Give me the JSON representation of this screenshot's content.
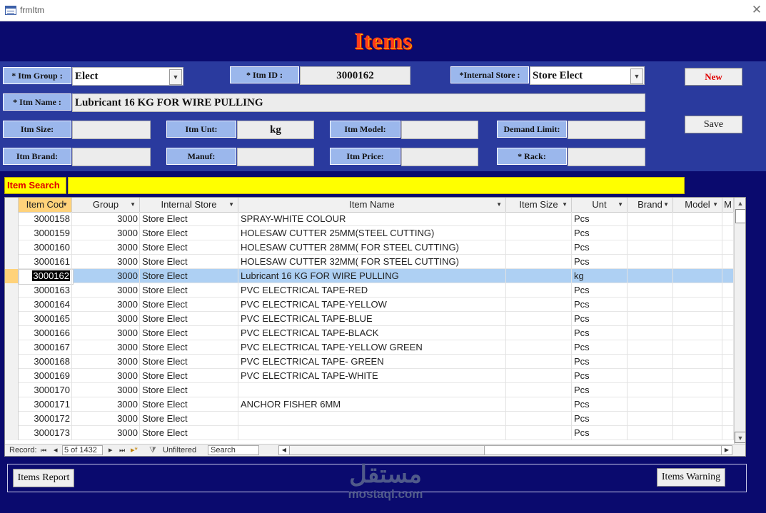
{
  "window": {
    "title": "frmItm",
    "close_glyph": "✕"
  },
  "header": {
    "title": "Items"
  },
  "form": {
    "group_label": "* Itm Group :",
    "group_value": "Elect",
    "id_label": "* Itm ID :",
    "id_value": "3000162",
    "store_label": "*Internal Store :",
    "store_value": "Store Elect",
    "name_label": "* Itm Name :",
    "name_value": "Lubricant 16 KG FOR WIRE PULLING",
    "size_label": "Itm Size:",
    "size_value": "",
    "unit_label": "Itm Unt:",
    "unit_value": "kg",
    "model_label": "Itm Model:",
    "model_value": "",
    "demand_label": "Demand Limit:",
    "demand_value": "",
    "brand_label": "Itm Brand:",
    "brand_value": "",
    "manuf_label": "Manuf:",
    "manuf_value": "",
    "price_label": "Itm Price:",
    "price_value": "",
    "rack_label": "* Rack:",
    "rack_value": "",
    "new_button": "New",
    "save_button": "Save",
    "new_color": "#e00000"
  },
  "search": {
    "label": "Item Search",
    "value": ""
  },
  "grid": {
    "columns": [
      "Item Cod",
      "Group",
      "Internal Store",
      "Item Name",
      "Item Size",
      "Unt",
      "Brand",
      "Model",
      "M"
    ],
    "rows": [
      {
        "code": "3000158",
        "group": "3000",
        "store": "Store Elect",
        "name": "SPRAY-WHITE COLOUR",
        "size": "",
        "unit": "Pcs"
      },
      {
        "code": "3000159",
        "group": "3000",
        "store": "Store Elect",
        "name": "HOLESAW CUTTER 25MM(STEEL CUTTING)",
        "size": "",
        "unit": "Pcs"
      },
      {
        "code": "3000160",
        "group": "3000",
        "store": "Store Elect",
        "name": "HOLESAW CUTTER 28MM( FOR STEEL CUTTING)",
        "size": "",
        "unit": "Pcs"
      },
      {
        "code": "3000161",
        "group": "3000",
        "store": "Store Elect",
        "name": "HOLESAW CUTTER 32MM( FOR STEEL CUTTING)",
        "size": "",
        "unit": "Pcs"
      },
      {
        "code": "3000162",
        "group": "3000",
        "store": "Store Elect",
        "name": "Lubricant 16 KG FOR WIRE PULLING",
        "size": "",
        "unit": "kg"
      },
      {
        "code": "3000163",
        "group": "3000",
        "store": "Store Elect",
        "name": "PVC ELECTRICAL TAPE-RED",
        "size": "",
        "unit": "Pcs"
      },
      {
        "code": "3000164",
        "group": "3000",
        "store": "Store Elect",
        "name": "PVC ELECTRICAL TAPE-YELLOW",
        "size": "",
        "unit": "Pcs"
      },
      {
        "code": "3000165",
        "group": "3000",
        "store": "Store Elect",
        "name": "PVC ELECTRICAL TAPE-BLUE",
        "size": "",
        "unit": "Pcs"
      },
      {
        "code": "3000166",
        "group": "3000",
        "store": "Store Elect",
        "name": "PVC ELECTRICAL TAPE-BLACK",
        "size": "",
        "unit": "Pcs"
      },
      {
        "code": "3000167",
        "group": "3000",
        "store": "Store Elect",
        "name": "PVC ELECTRICAL TAPE-YELLOW GREEN",
        "size": "",
        "unit": "Pcs"
      },
      {
        "code": "3000168",
        "group": "3000",
        "store": "Store Elect",
        "name": "PVC ELECTRICAL TAPE- GREEN",
        "size": "",
        "unit": "Pcs"
      },
      {
        "code": "3000169",
        "group": "3000",
        "store": "Store Elect",
        "name": "PVC ELECTRICAL TAPE-WHITE",
        "size": "",
        "unit": "Pcs"
      },
      {
        "code": "3000170",
        "group": "3000",
        "store": "Store Elect",
        "name": "",
        "size": "",
        "unit": "Pcs"
      },
      {
        "code": "3000171",
        "group": "3000",
        "store": "Store Elect",
        "name": "ANCHOR FISHER 6MM",
        "size": "",
        "unit": "Pcs"
      },
      {
        "code": "3000172",
        "group": "3000",
        "store": "Store Elect",
        "name": "",
        "size": "",
        "unit": "Pcs"
      },
      {
        "code": "3000173",
        "group": "3000",
        "store": "Store Elect",
        "name": "",
        "size": "",
        "unit": "Pcs"
      }
    ],
    "selected_index": 4
  },
  "navigation": {
    "record_label": "Record:",
    "first": "⏮",
    "prev": "◂",
    "current": "5 of 1432",
    "next": "▸",
    "last": "⏭",
    "new_rec": "▸*",
    "filter_status": "Unfiltered",
    "search_placeholder": "Search"
  },
  "footer": {
    "report_button": "Items Report",
    "warning_button": "Items Warning",
    "watermark_logo": "مستقل",
    "watermark_text": "mostaql.com"
  },
  "colors": {
    "background": "#0a0a6e",
    "form_band": "#2a3a9e",
    "label_bg": "#9bb7ec",
    "search_bg": "#ffff00",
    "selected_row": "#aed0f3",
    "active_header": "#ffd27a"
  }
}
